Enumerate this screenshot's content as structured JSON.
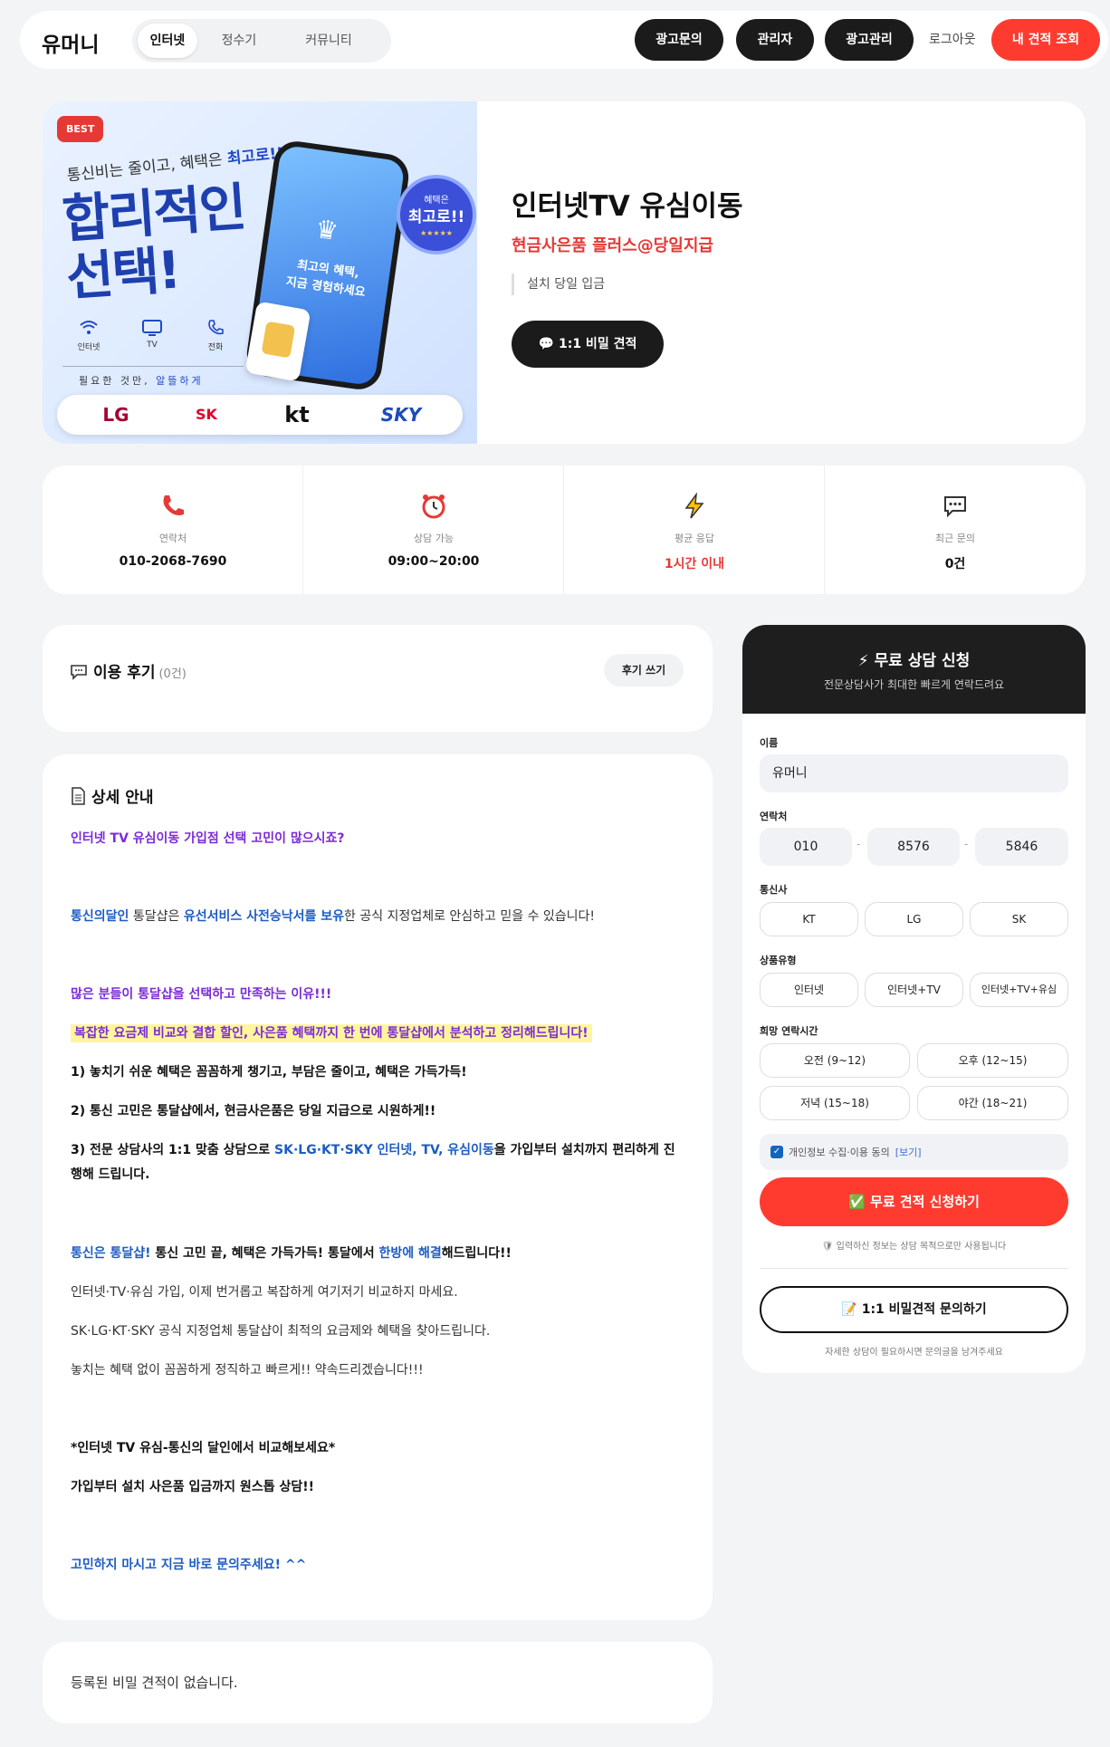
{
  "header": {
    "logo": "유머니",
    "tabs": [
      "인터넷",
      "정수기",
      "커뮤니티"
    ],
    "buttons": {
      "ad_inquiry": "광고문의",
      "admin": "관리자",
      "ad_manage": "광고관리",
      "logout": "로그아웃",
      "my_quote": "내 견적 조회"
    }
  },
  "banner": {
    "best": "BEST",
    "sub_pre": "통신비는 줄이고, 혜택은 ",
    "sub_em": "최고로!!",
    "title_line1": "합리적인",
    "title_line2": "선택!",
    "icons": [
      {
        "label": "인터넷",
        "icon": "wifi-icon"
      },
      {
        "label": "TV",
        "icon": "tv-icon"
      },
      {
        "label": "전화",
        "icon": "phone-icon"
      }
    ],
    "need_pre": "필요한 것만, ",
    "need_em": "알뜰하게",
    "phone_text_1": "최고의 혜택,",
    "phone_text_2": "지금 경험하세요",
    "badge_small": "혜택은",
    "badge_big": "최고로!!",
    "badge_stars": "★★★★★",
    "carriers": [
      "LG",
      "SK",
      "kt",
      "SKY"
    ]
  },
  "hero": {
    "title": "인터넷TV 유심이동",
    "subtitle": "현금사은품 플러스@당일지급",
    "note": "설치 당일 입금",
    "button": "💬 1:1 비밀 견적"
  },
  "stats": [
    {
      "icon": "phone-icon",
      "label": "연락처",
      "value": "010-2068-7690"
    },
    {
      "icon": "alarm-clock-icon",
      "label": "상담 가능",
      "value": "09:00~20:00"
    },
    {
      "icon": "lightning-icon",
      "label": "평균 응답",
      "value": "1시간 이내"
    },
    {
      "icon": "chat-icon",
      "label": "최근 문의",
      "value": "0건"
    }
  ],
  "colors": {
    "accent": "#ff3b30",
    "dark": "#1b1b1b",
    "response": "#e53935",
    "purple": "#7b2cd6",
    "blue": "#1d5cc4"
  },
  "reviews": {
    "title": "이용 후기",
    "count": "(0건)",
    "write": "후기 쓰기"
  },
  "detail": {
    "title": "상세 안내",
    "l1": "인터넷 TV 유심이동 가입점 선택 고민이 많으시죠?",
    "l2a": "통신의달인",
    "l2b": " 통달샵은 ",
    "l2c": "유선서비스 사전승낙서를 보유",
    "l2d": "한 공식 지정업체로 안심하고 믿을 수 있습니다!",
    "l3": "많은 분들이 통달샵을 선택하고 만족하는 이유!!!",
    "l4": "복잡한 요금제 비교와 결합 할인, 사은품 혜택까지 한 번에 통달샵에서 분석하고 정리해드립니다!",
    "l5": "1) 놓치기 쉬운 혜택은 꼼꼼하게 챙기고, 부담은 줄이고, 혜택은 가득가득!",
    "l6": "2) 통신 고민은 통달샵에서, 현금사은품은 당일 지급으로 시원하게!!",
    "l7a": "3) 전문 상담사의 1:1 맞춤 상담으로 ",
    "l7b": "SK·LG·KT·SKY 인터넷, TV, 유심이동",
    "l7c": "을 가입부터 설치까지 편리하게 진행해 드립니다.",
    "l8a": "통신은 통달샵!",
    "l8b": " 통신 고민 끝, 혜택은 가득가득! 통달에서 ",
    "l8c": "한방에 해결",
    "l8d": "해드립니다!!",
    "l9": "인터넷·TV·유심 가입, 이제 번거롭고 복잡하게 여기저기 비교하지 마세요.",
    "l10": "SK·LG·KT·SKY 공식 지정업체 통달샵이 최적의 요금제와 혜택을 찾아드립니다.",
    "l11": "놓치는 혜택 없이 꼼꼼하게 정직하고 빠르게!! 약속드리겠습니다!!!",
    "l12": "*인터넷 TV 유심-통신의 달인에서 비교해보세요*",
    "l13": "가입부터 설치 사은품 입금까지 원스톱 상담!!",
    "l14": "고민하지 마시고 지금 바로 문의주세요! ^^"
  },
  "bottom": {
    "text": "등록된 비밀 견적이 없습니다."
  },
  "form": {
    "title": "⚡ 무료 상담 신청",
    "subtitle": "전문상담사가 최대한 빠르게 연락드려요",
    "name_label": "이름",
    "name_value": "유머니",
    "phone_label": "연락처",
    "phone": [
      "010",
      "8576",
      "5846"
    ],
    "carrier_label": "통신사",
    "carriers": [
      "KT",
      "LG",
      "SK"
    ],
    "product_label": "상품유형",
    "products": [
      "인터넷",
      "인터넷+TV",
      "인터넷+TV+유심"
    ],
    "time_label": "희망 연락시간",
    "times": [
      "오전 (9~12)",
      "오후 (12~15)",
      "저녁 (15~18)",
      "야간 (18~21)"
    ],
    "agree": "개인정보 수집·이용 동의",
    "agree_link": "[보기]",
    "submit": "✅ 무료 견적 신청하기",
    "note": "🛡 입력하신 정보는 상담 목적으로만 사용됩니다",
    "secret": "📝 1:1 비밀견적 문의하기",
    "secret_note": "자세한 상담이 필요하시면 문의글을 남겨주세요"
  }
}
